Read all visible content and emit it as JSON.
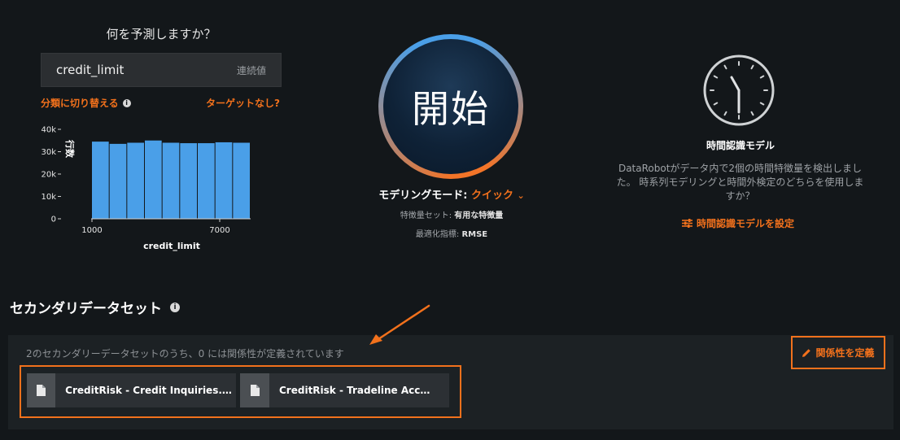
{
  "target": {
    "question": "何を予測しますか？",
    "value": "credit_limit",
    "kind": "連続値",
    "switch_link": "分類に切り替える",
    "no_target_link": "ターゲットなし?"
  },
  "histogram": {
    "y_axis_label": "行数",
    "x_axis_label": "credit_limit",
    "y_ticks": [
      "40k",
      "30k",
      "20k",
      "10k",
      "0"
    ],
    "x_ticks": [
      "1000",
      "7000"
    ]
  },
  "chart_data": {
    "type": "bar",
    "values": [
      34500,
      33500,
      34000,
      35000,
      34000,
      33800,
      33800,
      34200,
      34000
    ],
    "ylim": [
      0,
      40000
    ],
    "xlabel": "credit_limit",
    "ylabel": "行数"
  },
  "start": {
    "label": "開始",
    "mode_label": "モデリングモード:",
    "mode_value": "クイック",
    "feature_label": "特徴量セット:",
    "feature_value": "有用な特徴量",
    "metric_label": "最適化指標:",
    "metric_value": "RMSE"
  },
  "timeseries": {
    "title": "時間認識モデル",
    "description": "DataRobotがデータ内で2個の時間特徴量を検出しました。 時系列モデリングと時間外検定のどちらを使用しますか？",
    "link": "時間認識モデルを設定"
  },
  "secondary": {
    "title": "セカンダリデータセット",
    "summary": "2のセカンダリーデータセットのうち、0 には関係性が定義されています",
    "define_button": "関係性を定義",
    "files": [
      "CreditRisk - Credit Inquiries.csv",
      "CreditRisk - Tradeline Accounts.csv"
    ]
  },
  "colors": {
    "accent": "#f2711c",
    "bar": "#4a9fe8",
    "background": "#13171a"
  }
}
